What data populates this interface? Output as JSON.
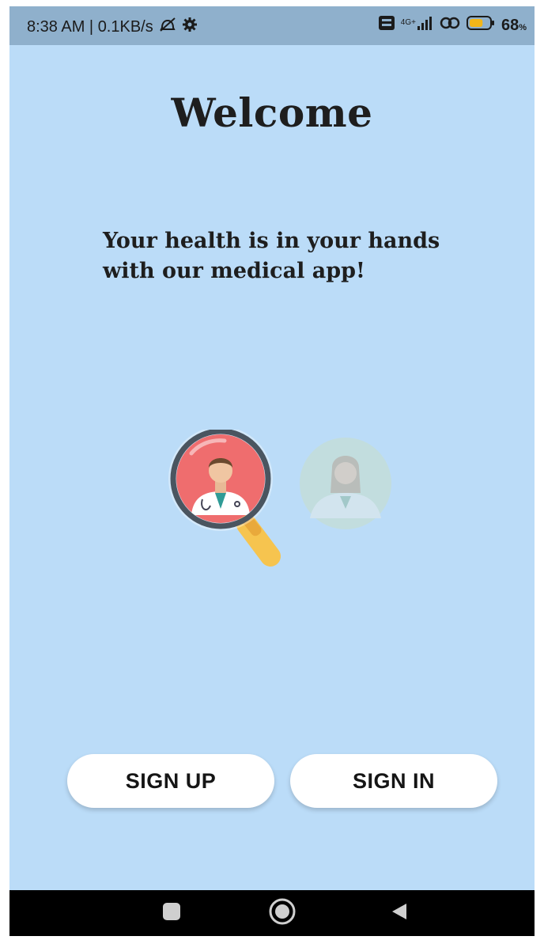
{
  "status_bar": {
    "time_speed": "8:38 AM | 0.1KB/s",
    "network": "4G+",
    "battery_percent": "68",
    "battery_unit": "%",
    "battery_level": 0.68,
    "icons": [
      "muted-alarm-icon",
      "gear-icon",
      "volte-icon",
      "signal-icon",
      "hotspot-icon",
      "battery-icon"
    ]
  },
  "main": {
    "title": "Welcome",
    "tagline_line1": "Your health is in your hands",
    "tagline_line2": "with our medical app!",
    "illustration_icons": [
      "magnifier-icon",
      "male-doctor-icon",
      "female-doctor-icon"
    ]
  },
  "actions": {
    "sign_up_label": "SIGN UP",
    "sign_in_label": "SIGN IN"
  },
  "nav_bar": {
    "icons": [
      "recents-square-icon",
      "home-circle-icon",
      "back-triangle-icon"
    ]
  },
  "colors": {
    "background": "#bbdcf8",
    "status_bar": "#8fb0cc",
    "button": "#ffffff",
    "battery": "#f2b619",
    "magnifier_handle": "#f6c44f",
    "lens_ring": "#4a5560",
    "lens_fill": "#ef6d6e"
  }
}
